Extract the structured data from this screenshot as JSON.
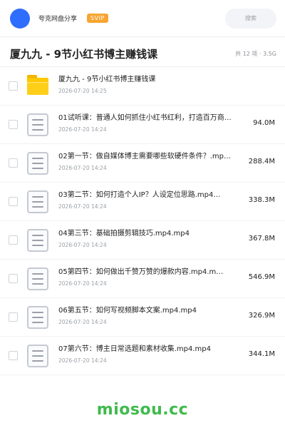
{
  "header": {
    "brand": "夸克网盘分享",
    "badge": "SVIP",
    "search_label": "搜索"
  },
  "share": {
    "title": "厦九九 - 9节小红书博主赚钱课",
    "meta": "共 12 项 · 3.5G"
  },
  "files": [
    {
      "name": "厦九九 - 9节小红书博主赚钱课",
      "date": "2026-07-20 14:25",
      "size": "",
      "type": "folder"
    },
    {
      "name": "01试听课：普通人如何抓住小红书红利，打造百万商业…",
      "date": "2026-07-20 14:24",
      "size": "94.0M",
      "type": "file"
    },
    {
      "name": "02第一节：做自媒体博主需要哪些软硬件条件？.mp…",
      "date": "2026-07-20 14:24",
      "size": "288.4M",
      "type": "file"
    },
    {
      "name": "03第二节：如何打造个人IP？人设定位思路.mp4…",
      "date": "2026-07-20 14:24",
      "size": "338.3M",
      "type": "file"
    },
    {
      "name": "04第三节：基础拍摄剪辑技巧.mp4.mp4",
      "date": "2026-07-20 14:24",
      "size": "367.8M",
      "type": "file"
    },
    {
      "name": "05第四节：如何做出千赞万赞的爆款内容.mp4.m…",
      "date": "2026-07-20 14:24",
      "size": "546.9M",
      "type": "file"
    },
    {
      "name": "06第五节：如何写视频脚本文案.mp4.mp4",
      "date": "2026-07-20 14:24",
      "size": "326.9M",
      "type": "file"
    },
    {
      "name": "07第六节：博主日常选题和素材收集.mp4.mp4",
      "date": "2026-07-20 14:24",
      "size": "344.1M",
      "type": "file"
    }
  ],
  "watermark": "miosou.cc",
  "colors": {
    "avatar": "#2f6dff",
    "svip_badge": "#f7a531",
    "folder": "#ffc800",
    "watermark": "#3fba4d"
  }
}
